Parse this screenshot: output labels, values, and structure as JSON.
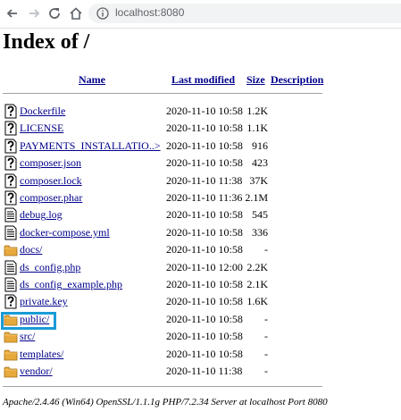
{
  "browser": {
    "url": "localhost:8080",
    "icons": [
      "back-arrow-icon",
      "forward-arrow-icon",
      "reload-icon",
      "home-icon",
      "info-icon"
    ]
  },
  "page": {
    "title": "Index of /"
  },
  "table": {
    "headers": {
      "name": "Name",
      "last_modified": "Last modified",
      "size": "Size",
      "description": "Description"
    },
    "rows": [
      {
        "name": "Dockerfile",
        "date": "2020-11-10 10:58",
        "size": "1.2K",
        "type": "unknown-file-icon"
      },
      {
        "name": "LICENSE",
        "date": "2020-11-10 10:58",
        "size": "1.1K",
        "type": "unknown-file-icon"
      },
      {
        "name": "PAYMENTS_INSTALLATIO..>",
        "date": "2020-11-10 10:58",
        "size": "916",
        "type": "unknown-file-icon"
      },
      {
        "name": "composer.json",
        "date": "2020-11-10 10:58",
        "size": "423",
        "type": "unknown-file-icon"
      },
      {
        "name": "composer.lock",
        "date": "2020-11-10 11:38",
        "size": "37K",
        "type": "unknown-file-icon"
      },
      {
        "name": "composer.phar",
        "date": "2020-11-10 11:36",
        "size": "2.1M",
        "type": "unknown-file-icon"
      },
      {
        "name": "debug.log",
        "date": "2020-11-10 10:58",
        "size": "545",
        "type": "text-file-icon"
      },
      {
        "name": "docker-compose.yml",
        "date": "2020-11-10 10:58",
        "size": "336",
        "type": "text-file-icon"
      },
      {
        "name": "docs/",
        "date": "2020-11-10 10:58",
        "size": "-",
        "type": "folder-icon"
      },
      {
        "name": "ds_config.php",
        "date": "2020-11-10 12:00",
        "size": "2.2K",
        "type": "text-file-icon"
      },
      {
        "name": "ds_config_example.php",
        "date": "2020-11-10 10:58",
        "size": "2.1K",
        "type": "text-file-icon"
      },
      {
        "name": "private.key",
        "date": "2020-11-10 10:58",
        "size": "1.6K",
        "type": "unknown-file-icon"
      },
      {
        "name": "public/",
        "date": "2020-11-10 10:58",
        "size": "-",
        "type": "folder-icon"
      },
      {
        "name": "src/",
        "date": "2020-11-10 10:58",
        "size": "-",
        "type": "folder-icon"
      },
      {
        "name": "templates/",
        "date": "2020-11-10 10:58",
        "size": "-",
        "type": "folder-icon"
      },
      {
        "name": "vendor/",
        "date": "2020-11-10 11:38",
        "size": "-",
        "type": "folder-icon"
      }
    ]
  },
  "footer": {
    "text": "Apache/2.4.46 (Win64) OpenSSL/1.1.1g PHP/7.2.34 Server at localhost Port 8080"
  },
  "colors": {
    "link": "#00008b",
    "highlight": "#1a9bd7",
    "folder": "#e8a93c"
  }
}
